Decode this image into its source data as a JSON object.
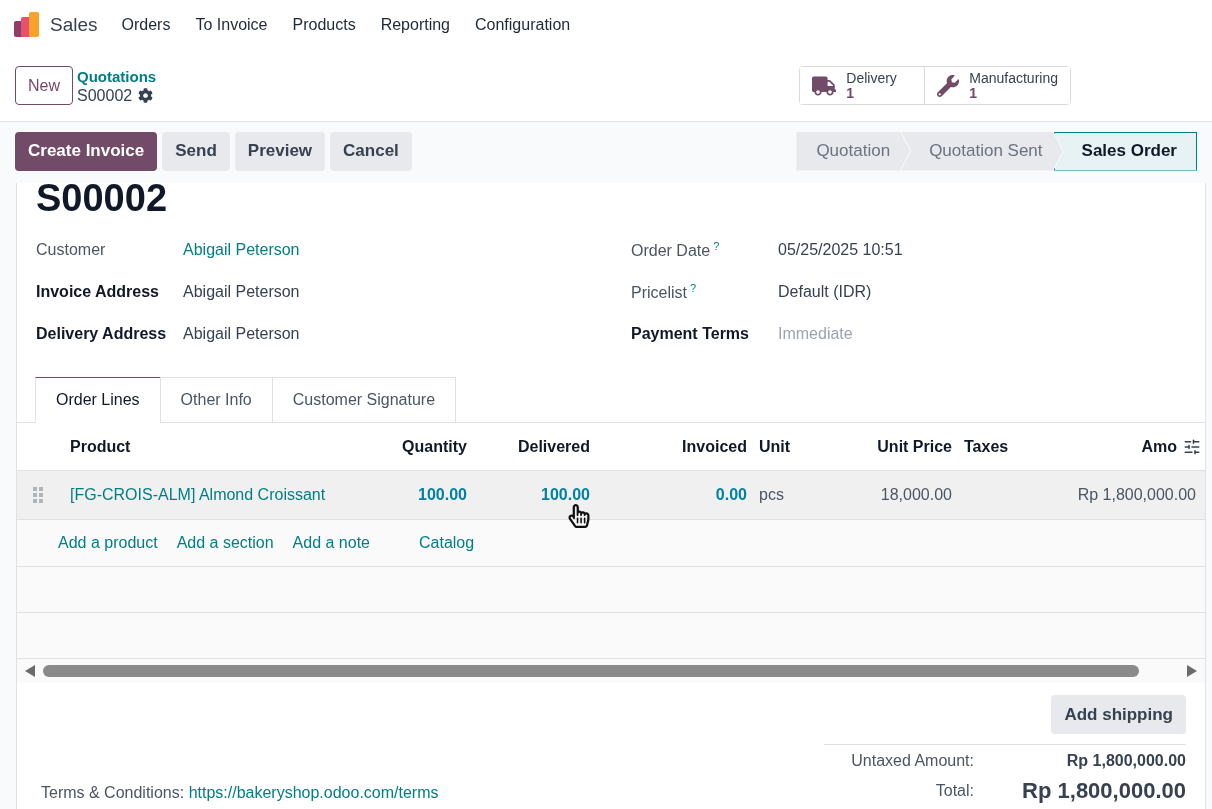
{
  "nav": {
    "app": "Sales",
    "menu": [
      "Orders",
      "To Invoice",
      "Products",
      "Reporting",
      "Configuration"
    ]
  },
  "breadcrumb": {
    "new_button": "New",
    "parent": "Quotations",
    "record": "S00002"
  },
  "smart_buttons": [
    {
      "kind": "delivery",
      "label": "Delivery",
      "count": "1"
    },
    {
      "kind": "manufacturing",
      "label": "Manufacturing",
      "count": "1"
    }
  ],
  "actions": [
    {
      "label": "Create Invoice",
      "primary": true
    },
    {
      "label": "Send",
      "primary": false
    },
    {
      "label": "Preview",
      "primary": false
    },
    {
      "label": "Cancel",
      "primary": false
    }
  ],
  "status_steps": [
    {
      "label": "Quotation",
      "selected": false
    },
    {
      "label": "Quotation Sent",
      "selected": false
    },
    {
      "label": "Sales Order",
      "selected": true
    }
  ],
  "title": "S00002",
  "fields_left": [
    {
      "label": "Customer",
      "strong": false,
      "value": "Abigail Peterson",
      "kind": "link"
    },
    {
      "label": "Invoice Address",
      "strong": true,
      "value": "Abigail Peterson",
      "kind": "text"
    },
    {
      "label": "Delivery Address",
      "strong": true,
      "value": "Abigail Peterson",
      "kind": "text"
    }
  ],
  "fields_right": [
    {
      "label": "Order Date",
      "strong": false,
      "help": "?",
      "value": "05/25/2025 10:51",
      "kind": "text"
    },
    {
      "label": "Pricelist",
      "strong": false,
      "help": "?",
      "value": "Default (IDR)",
      "kind": "text"
    },
    {
      "label": "Payment Terms",
      "strong": true,
      "placeholder": "Immediate",
      "kind": "field"
    }
  ],
  "tabs": [
    {
      "label": "Order Lines",
      "selected": true
    },
    {
      "label": "Other Info",
      "selected": false
    },
    {
      "label": "Customer Signature",
      "selected": false
    }
  ],
  "table": {
    "columns": [
      "Product",
      "Quantity",
      "Delivered",
      "Invoiced",
      "Unit",
      "Unit Price",
      "Taxes",
      "Amo"
    ],
    "rows": [
      {
        "cells": [
          {
            "text": "[FG-CROIS-ALM] Almond Croissant",
            "kind": "link"
          },
          {
            "text": "100.00",
            "kind": "link_number"
          },
          {
            "text": "100.00",
            "kind": "link_number"
          },
          {
            "text": "0.00",
            "kind": "link_number"
          },
          {
            "text": "pcs",
            "kind": "text"
          },
          {
            "text": "18,000.00",
            "kind": "number"
          },
          {
            "kind": "empty"
          },
          {
            "text": "Rp 1,800,000.00",
            "kind": "number"
          }
        ]
      }
    ],
    "add_links": [
      "Add a product",
      "Add a section",
      "Add a note",
      "Catalog"
    ]
  },
  "add_shipping": "Add shipping",
  "terms": {
    "label": "Terms & Conditions:",
    "link": "https://bakeryshop.odoo.com/terms"
  },
  "totals": [
    {
      "label": "Untaxed Amount:",
      "value": "Rp 1,800,000.00",
      "grand": false
    },
    {
      "label": "Total:",
      "value": "Rp 1,800,000.00",
      "grand": true
    }
  ]
}
